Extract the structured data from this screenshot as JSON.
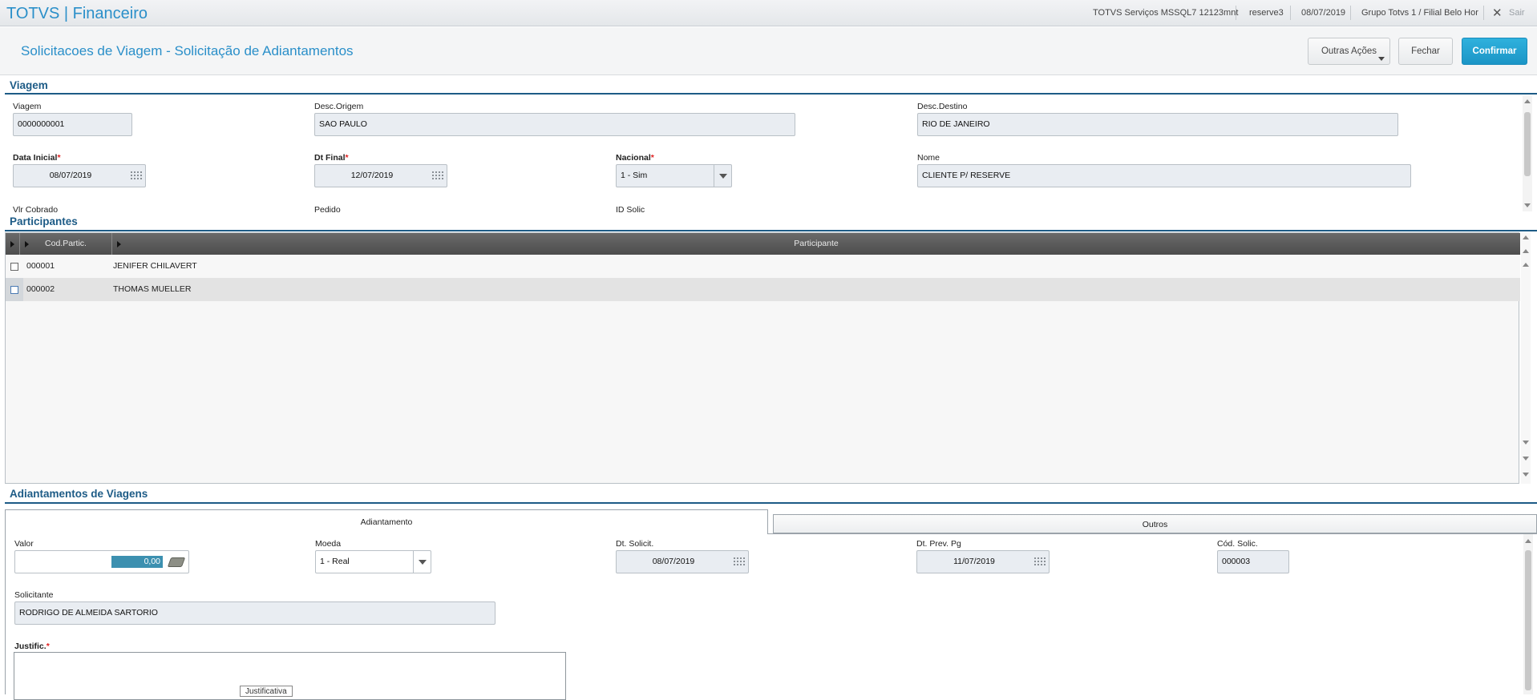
{
  "topbar": {
    "app_title": "TOTVS | Financeiro",
    "environment": "TOTVS Serviços MSSQL7 12123mnt",
    "user": "reserve3",
    "date": "08/07/2019",
    "branch": "Grupo Totvs 1 / Filial Belo Hor",
    "logout": "Sair"
  },
  "header": {
    "page_title": "Solicitacoes de Viagem - Solicitação de Adiantamentos",
    "more_actions": "Outras Ações",
    "close": "Fechar",
    "confirm": "Confirmar"
  },
  "viagem": {
    "section_title": "Viagem",
    "viagem_label": "Viagem",
    "viagem_value": "0000000001",
    "origem_label": "Desc.Origem",
    "origem_value": "SAO PAULO",
    "destino_label": "Desc.Destino",
    "destino_value": "RIO DE JANEIRO",
    "data_inicial_label": "Data Inicial",
    "data_inicial_value": "08/07/2019",
    "dt_final_label": "Dt Final",
    "dt_final_value": "12/07/2019",
    "nacional_label": "Nacional",
    "nacional_value": "1 - Sim",
    "nome_label": "Nome",
    "nome_value": "CLIENTE P/ RESERVE",
    "vlr_cobrado_label": "Vlr Cobrado",
    "pedido_label": "Pedido",
    "id_solic_label": "ID Solic"
  },
  "participantes": {
    "section_title": "Participantes",
    "columns": [
      "Cod.Partic.",
      "Participante"
    ],
    "rows": [
      {
        "cod": "000001",
        "nome": "JENIFER CHILAVERT"
      },
      {
        "cod": "000002",
        "nome": "THOMAS MUELLER"
      }
    ]
  },
  "adiantamentos": {
    "section_title": "Adiantamentos de Viagens",
    "tabs": [
      "Adiantamento",
      "Outros"
    ],
    "valor_label": "Valor",
    "valor_value": "0,00",
    "moeda_label": "Moeda",
    "moeda_value": "1 - Real",
    "dt_solicit_label": "Dt. Solicit.",
    "dt_solicit_value": "08/07/2019",
    "dt_prev_label": "Dt. Prev. Pg",
    "dt_prev_value": "11/07/2019",
    "cod_solic_label": "Cód. Solic.",
    "cod_solic_value": "000003",
    "solicitante_label": "Solicitante",
    "solicitante_value": "RODRIGO DE ALMEIDA SARTORIO",
    "justific_label": "Justific.",
    "justific_tooltip": "Justificativa"
  },
  "colors": {
    "accent": "#2a8fc9",
    "section": "#1d5b86",
    "primary_button": "#1b95c6",
    "required": "#e02020"
  }
}
